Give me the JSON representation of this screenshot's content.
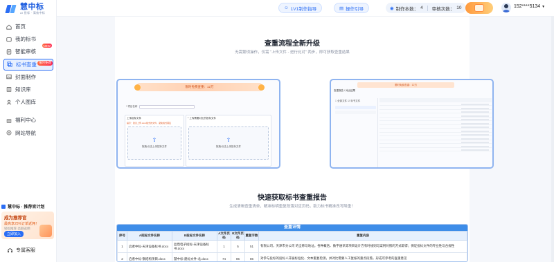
{
  "brand": {
    "name": "慧中标",
    "tagline": "AI 投标 · 高效中标"
  },
  "sidebar": {
    "items": [
      {
        "label": "首页",
        "icon": "home-icon"
      },
      {
        "label": "我的标书",
        "icon": "folder-icon"
      },
      {
        "label": "智能审核",
        "icon": "review-icon",
        "badge": "NEW"
      },
      {
        "label": "标书查重",
        "icon": "duplicate-check-icon",
        "badge": "限时免费",
        "active": true
      },
      {
        "label": "封面制作",
        "icon": "image-icon"
      },
      {
        "label": "知识库",
        "icon": "book-icon"
      },
      {
        "label": "个人图库",
        "icon": "gallery-icon"
      },
      {
        "label": "福利中心",
        "icon": "gift-icon"
      },
      {
        "label": "网站导航",
        "icon": "compass-icon"
      }
    ],
    "promo": {
      "title": "慧中标 · 推荐官计划",
      "heading": "成为推荐官",
      "line1": "最高享25%订单返佣！",
      "line2": "轻松推荐·高额返佣",
      "button": "立即加入"
    },
    "exclusive": "专属客服"
  },
  "topbar": {
    "guide_label": "1V1制作指导",
    "op_label": "操作引导",
    "counter": {
      "make_label": "制作本数：",
      "make_value": "4",
      "review_label": "审核次数：",
      "review_value": "10"
    },
    "user_phone": "152****5134"
  },
  "main": {
    "section1": {
      "title": "查重流程全新升级",
      "subtitle": "无需繁琐操作，仅需 \"上传文件 - 进行比对\" 两步，即可获取查重结果",
      "shot_a": {
        "banner": "限时免费查重：12万",
        "search_label": "* 项目名称",
        "box1_title": "上传招标文件",
        "box1_warn": "提示：建议上传.docx格式的文件，避免格式错乱",
        "box1_upload": "拖拽/点击上传招标文件",
        "box2_title": "* 上传需要对比的投标文件",
        "box2_upload": "拖拽/点击上传投标文件"
      },
      "shot_b": {
        "banner": "限时免费查重：12万",
        "title": "查重报告 / 对比结果",
        "tab1": "□ 全部文件",
        "tab2": "☑ 标书文件"
      }
    },
    "section2": {
      "title": "快速获取标书查重报告",
      "subtitle": "生成清晰查重清单，精准标明重复段落对应页码，助力标书精准改写降重！",
      "report": {
        "header": "查重详情",
        "columns": [
          "序号",
          "A招标文件名称",
          "B投标文件名称",
          "A文件页码",
          "B文件页码",
          "重复字数",
          "重复内容"
        ],
        "rows": [
          [
            "1",
            "启者中标-天津设备标书.docx",
            "盈鼎电子招标-天津设备标书.docx",
            "1",
            "5",
            "51",
            "有限公司，天津市分公司 的全称与地址。各种概括、数字通讯等项目设计方有时规则与案例对照的方式取得；保证投标文件的专业性与合规性"
          ],
          [
            "2",
            "启者中标-钢结构项目.docx",
            "慧中标-建标文件-北.docx",
            "74",
            "86",
            "86",
            "对参与投标的投标人开展标准化、文本重复检测，并对比需要人工复核的重点段落，形成可参考的查重意见"
          ]
        ]
      }
    }
  },
  "colors": {
    "accent": "#2a6df4",
    "badge": "#ff2d55",
    "report_header": "#3e8de8"
  }
}
